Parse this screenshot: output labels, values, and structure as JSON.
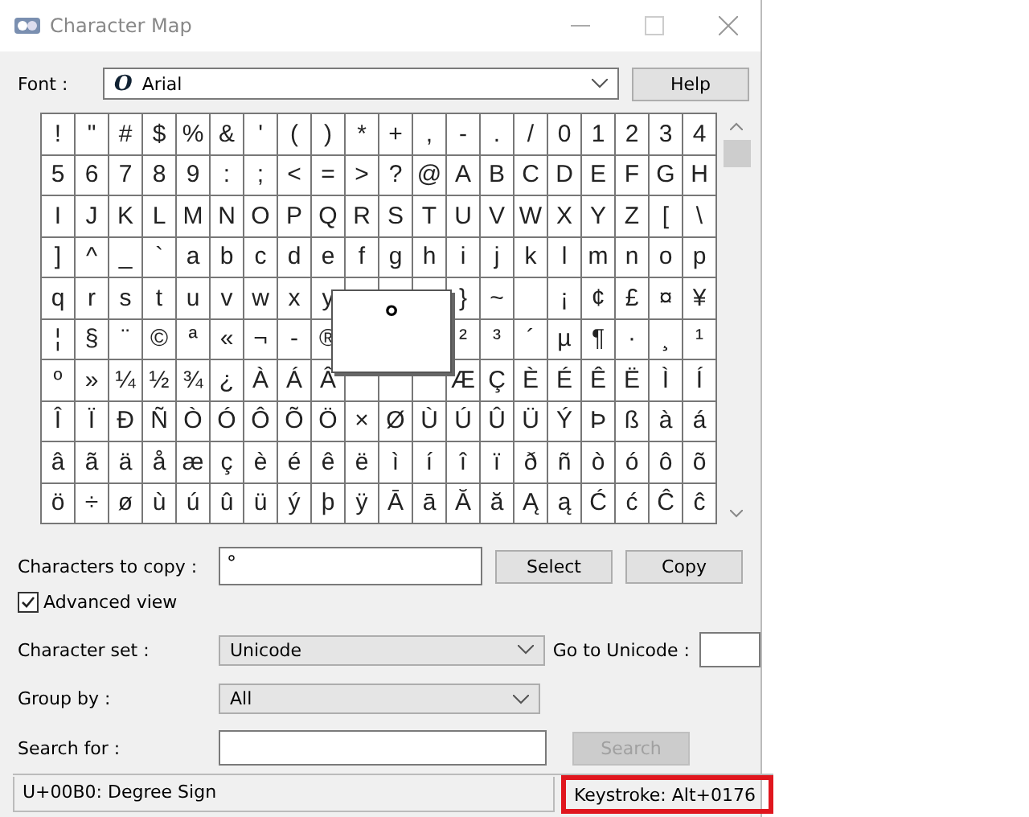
{
  "window": {
    "title": "Character Map"
  },
  "font": {
    "label": "Font :",
    "value": "Arial",
    "icon_glyph": "O"
  },
  "help_button": "Help",
  "grid": {
    "rows": [
      [
        "!",
        "\"",
        "#",
        "$",
        "%",
        "&",
        "'",
        "(",
        ")",
        "*",
        "+",
        ",",
        "-",
        ".",
        "/",
        "0",
        "1",
        "2",
        "3",
        "4"
      ],
      [
        "5",
        "6",
        "7",
        "8",
        "9",
        ":",
        ";",
        "<",
        "=",
        ">",
        "?",
        "@",
        "A",
        "B",
        "C",
        "D",
        "E",
        "F",
        "G",
        "H"
      ],
      [
        "I",
        "J",
        "K",
        "L",
        "M",
        "N",
        "O",
        "P",
        "Q",
        "R",
        "S",
        "T",
        "U",
        "V",
        "W",
        "X",
        "Y",
        "Z",
        "[",
        "\\"
      ],
      [
        "]",
        "^",
        "_",
        "`",
        "a",
        "b",
        "c",
        "d",
        "e",
        "f",
        "g",
        "h",
        "i",
        "j",
        "k",
        "l",
        "m",
        "n",
        "o",
        "p"
      ],
      [
        "q",
        "r",
        "s",
        "t",
        "u",
        "v",
        "w",
        "x",
        "y",
        null,
        null,
        null,
        "}",
        "~",
        null,
        "¡",
        "¢",
        "£",
        "¤",
        "¥"
      ],
      [
        "¦",
        "§",
        "¨",
        "©",
        "ª",
        "«",
        "¬",
        "-",
        "®",
        null,
        null,
        null,
        "²",
        "³",
        "´",
        "µ",
        "¶",
        "·",
        "¸",
        "¹"
      ],
      [
        "º",
        "»",
        "¼",
        "½",
        "¾",
        "¿",
        "À",
        "Á",
        "Â",
        null,
        null,
        null,
        "Æ",
        "Ç",
        "È",
        "É",
        "Ê",
        "Ë",
        "Ì",
        "Í"
      ],
      [
        "Î",
        "Ï",
        "Ð",
        "Ñ",
        "Ò",
        "Ó",
        "Ô",
        "Õ",
        "Ö",
        "×",
        "Ø",
        "Ù",
        "Ú",
        "Û",
        "Ü",
        "Ý",
        "Þ",
        "ß",
        "à",
        "á"
      ],
      [
        "â",
        "ã",
        "ä",
        "å",
        "æ",
        "ç",
        "è",
        "é",
        "ê",
        "ë",
        "ì",
        "í",
        "î",
        "ï",
        "ð",
        "ñ",
        "ò",
        "ó",
        "ô",
        "õ"
      ],
      [
        "ö",
        "÷",
        "ø",
        "ù",
        "ú",
        "û",
        "ü",
        "ý",
        "þ",
        "ÿ",
        "Ā",
        "ā",
        "Ă",
        "ă",
        "Ą",
        "ą",
        "Ć",
        "ć",
        "Ĉ",
        "ĉ"
      ]
    ],
    "magnified": "°"
  },
  "copy": {
    "label": "Characters to copy :",
    "value": "°",
    "select_button": "Select",
    "copy_button": "Copy"
  },
  "advanced_view": {
    "label": "Advanced view",
    "checked": true
  },
  "character_set": {
    "label": "Character set :",
    "value": "Unicode"
  },
  "goto_unicode": {
    "label": "Go to Unicode :"
  },
  "group_by": {
    "label": "Group by :",
    "value": "All"
  },
  "search": {
    "label": "Search for :",
    "button": "Search",
    "button_disabled": true
  },
  "status_bar": {
    "description": "U+00B0: Degree Sign",
    "keystroke": "Keystroke: Alt+0176"
  }
}
